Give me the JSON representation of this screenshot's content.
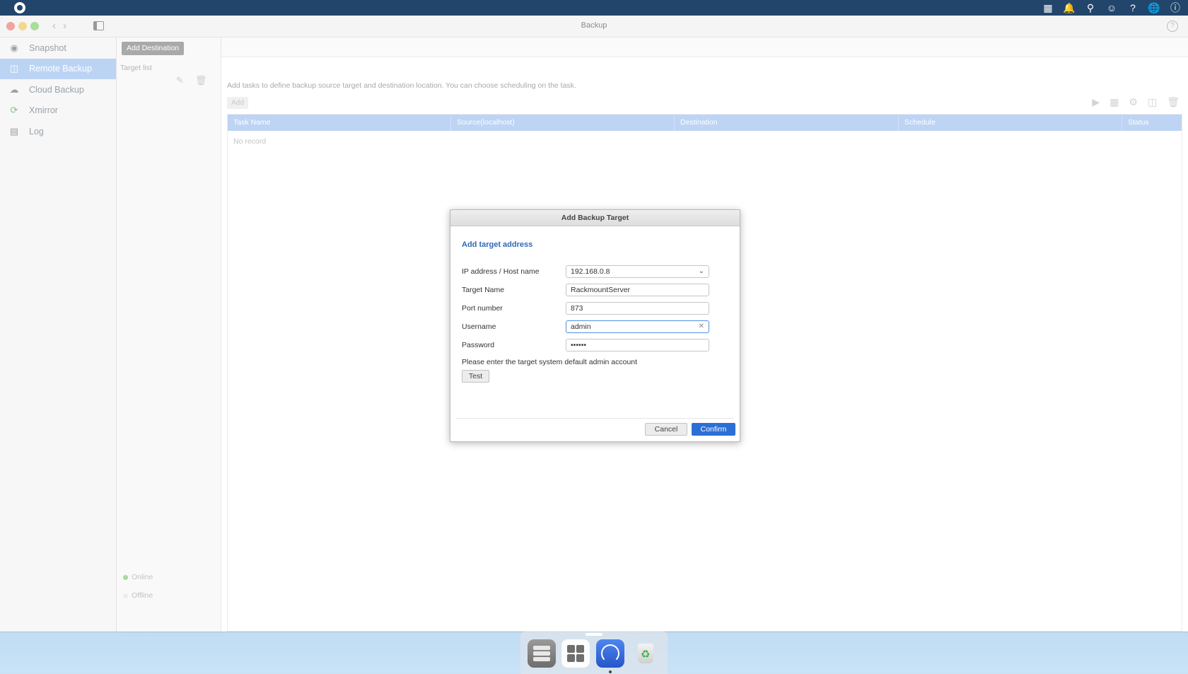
{
  "window": {
    "title": "Backup"
  },
  "sidebar": {
    "items": [
      {
        "label": "Snapshot",
        "icon": "snapshot-icon"
      },
      {
        "label": "Remote Backup",
        "icon": "remote-backup-icon",
        "active": true
      },
      {
        "label": "Cloud Backup",
        "icon": "cloud-backup-icon"
      },
      {
        "label": "Xmirror",
        "icon": "xmirror-icon"
      },
      {
        "label": "Log",
        "icon": "log-icon"
      }
    ]
  },
  "targets": {
    "add_destination": "Add Destination",
    "list_label": "Target list",
    "online_label": "Online",
    "offline_label": "Offline"
  },
  "main": {
    "hint": "Add tasks to define backup source target and destination location. You can choose scheduling on the task.",
    "add_label": "Add",
    "table": {
      "headers": [
        "Task Name",
        "Source(localhost)",
        "Destination",
        "Schedule",
        "Status"
      ],
      "empty_text": "No record"
    }
  },
  "dialog": {
    "title": "Add Backup Target",
    "subtitle": "Add target address",
    "fields": {
      "host": {
        "label": "IP address / Host name",
        "value": "192.168.0.8"
      },
      "target_name": {
        "label": "Target Name",
        "value": "RackmountServer"
      },
      "port": {
        "label": "Port number",
        "value": "873"
      },
      "username": {
        "label": "Username",
        "value": "admin"
      },
      "password": {
        "label": "Password",
        "value": "••••••"
      }
    },
    "note": "Please enter the target system default admin account",
    "test_label": "Test",
    "cancel_label": "Cancel",
    "confirm_label": "Confirm"
  },
  "colors": {
    "accent": "#2b6fd6",
    "selection": "#bcd4f4",
    "topbar": "#22466b"
  }
}
